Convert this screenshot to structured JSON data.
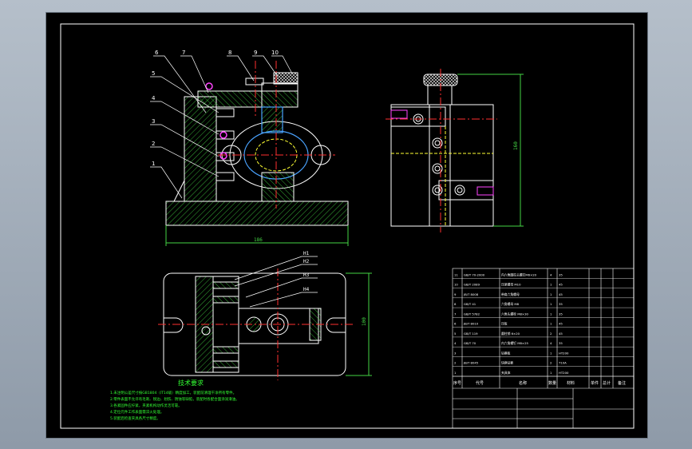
{
  "colors": {
    "background": "#000000",
    "frame": "#ffffff",
    "part": "#ffffff",
    "hatch": "#44d444",
    "centerline": "#ff3030",
    "hidden": "#ffff33",
    "dimension": "#44d444",
    "text_green": "#33ff33",
    "bolt": "#ff44ff",
    "bushing": "#4aa3ff"
  },
  "front_view": {
    "balloons": [
      "6",
      "7",
      "8",
      "9",
      "10"
    ],
    "left_balloons": [
      "5",
      "4",
      "3",
      "2",
      "1"
    ],
    "width_dim": "186"
  },
  "side_view": {
    "height_dim": "160"
  },
  "top_view": {
    "callouts": [
      "H1",
      "H2",
      "H3",
      "H4"
    ],
    "height_dim": "100"
  },
  "tech_requirements": {
    "title": "技术要求",
    "lines": [
      "1.未注明公差尺寸按GB1804（IT14级）精度加工，装配前清理干净所有零件。",
      "2.零件表面不允许有毛刺、锐边、划伤、锈蚀等缺陷，装配时各配合面涂润滑油。",
      "3.各紧固件应拧紧，夹紧机构动作灵活可靠。",
      "4.定位元件工作表面需淬火处理。",
      "5.装配后检查夹具各尺寸精度。"
    ]
  },
  "bom": {
    "header": [
      "序号",
      "代号",
      "名称",
      "数量",
      "材料",
      "单件",
      "总计",
      "备注"
    ],
    "rows": [
      {
        "no": "11",
        "code": "GB/T 70-2000",
        "name": "内六角圆柱头螺钉M6×20",
        "qty": "4",
        "material": "35"
      },
      {
        "no": "10",
        "code": "GB/T 2089",
        "name": "压紧螺母 M10",
        "qty": "1",
        "material": "45"
      },
      {
        "no": "9",
        "code": "JB/T 8008",
        "name": "带肩六角螺母",
        "qty": "1",
        "material": "45"
      },
      {
        "no": "8",
        "code": "GB/T 41",
        "name": "六角螺母 M8",
        "qty": "1",
        "material": "35"
      },
      {
        "no": "7",
        "code": "GB/T 5782",
        "name": "六角头螺栓 M8×30",
        "qty": "1",
        "material": "35"
      },
      {
        "no": "6",
        "code": "JB/T 8010",
        "name": "压板",
        "qty": "1",
        "material": "45"
      },
      {
        "no": "5",
        "code": "GB/T 119",
        "name": "圆柱销 6×20",
        "qty": "2",
        "material": "45"
      },
      {
        "no": "4",
        "code": "GB/T 70",
        "name": "内六角螺钉 M8×25",
        "qty": "4",
        "material": "35"
      },
      {
        "no": "3",
        "code": "",
        "name": "钻模板",
        "qty": "1",
        "material": "HT200"
      },
      {
        "no": "2",
        "code": "JB/T 8045",
        "name": "快换钻套",
        "qty": "2",
        "material": "T10A"
      },
      {
        "no": "1",
        "code": "",
        "name": "夹具体",
        "qty": "1",
        "material": "HT200"
      }
    ]
  }
}
